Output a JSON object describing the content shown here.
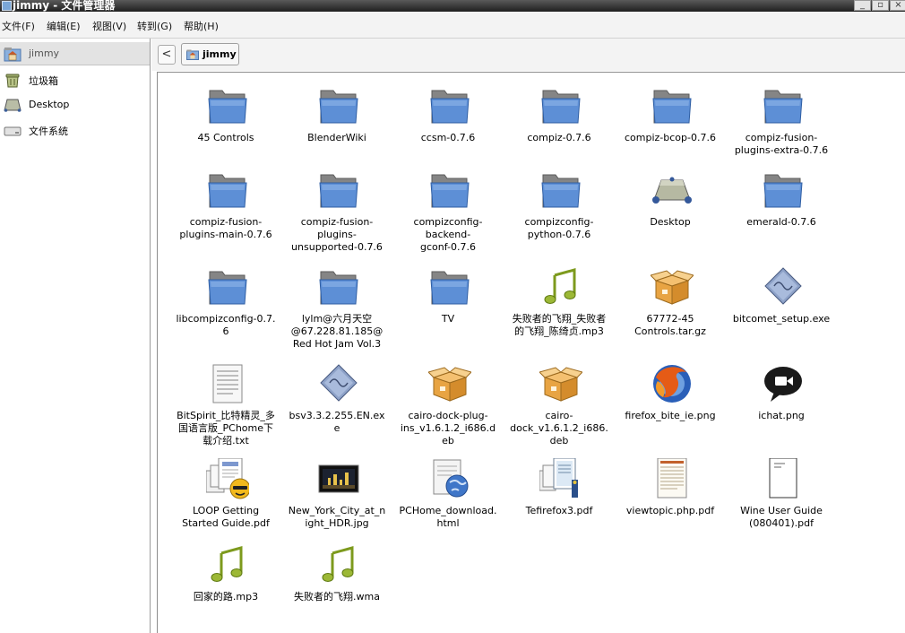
{
  "window": {
    "title": "jimmy - 文件管理器"
  },
  "menu": [
    "文件(F)",
    "编辑(E)",
    "视图(V)",
    "转到(G)",
    "帮助(H)"
  ],
  "sidebar": {
    "items": [
      {
        "label": "jimmy",
        "icon": "home-folder-icon",
        "selected": true
      },
      {
        "label": "垃圾箱",
        "icon": "trash-icon"
      },
      {
        "label": "Desktop",
        "icon": "desktop-icon"
      },
      {
        "label": "文件系统",
        "icon": "harddisk-icon"
      }
    ]
  },
  "pathbar": {
    "back_label": "<",
    "crumb": "jimmy",
    "crumb_icon": "home-folder-icon"
  },
  "files": [
    {
      "label": "45 Controls",
      "icon": "folder"
    },
    {
      "label": "BlenderWiki",
      "icon": "folder"
    },
    {
      "label": "ccsm-0.7.6",
      "icon": "folder"
    },
    {
      "label": "compiz-0.7.6",
      "icon": "folder"
    },
    {
      "label": "compiz-bcop-0.7.6",
      "icon": "folder"
    },
    {
      "label": "compiz-fusion-\nplugins-extra-0.7.6",
      "icon": "folder"
    },
    {
      "label": "compiz-fusion-\nplugins-main-0.7.6",
      "icon": "folder"
    },
    {
      "label": "compiz-fusion-\nplugins-\nunsupported-0.7.6",
      "icon": "folder"
    },
    {
      "label": "compizconfig-\nbackend-\ngconf-0.7.6",
      "icon": "folder"
    },
    {
      "label": "compizconfig-\npython-0.7.6",
      "icon": "folder"
    },
    {
      "label": "Desktop",
      "icon": "desktop"
    },
    {
      "label": "emerald-0.7.6",
      "icon": "folder"
    },
    {
      "label": "libcompizconfig-0.7.\n6",
      "icon": "folder"
    },
    {
      "label": "lylm@六月天空\n@67.228.81.185@\nRed Hot Jam Vol.3",
      "icon": "folder"
    },
    {
      "label": "TV",
      "icon": "folder"
    },
    {
      "label": "失败者的飞翔_失败者\n的飞翔_陈绮贞.mp3",
      "icon": "music"
    },
    {
      "label": "67772-45\nControls.tar.gz",
      "icon": "package"
    },
    {
      "label": "bitcomet_setup.exe",
      "icon": "executable"
    },
    {
      "label": "BitSpirit_比特精灵_多\n国语言版_PChome下\n载介绍.txt",
      "icon": "text"
    },
    {
      "label": "bsv3.3.2.255.EN.ex\ne",
      "icon": "executable"
    },
    {
      "label": "cairo-dock-plug-\nins_v1.6.1.2_i686.d\neb",
      "icon": "package"
    },
    {
      "label": "cairo-\ndock_v1.6.1.2_i686.\ndeb",
      "icon": "package"
    },
    {
      "label": "firefox_bite_ie.png",
      "icon": "firefox-image"
    },
    {
      "label": "ichat.png",
      "icon": "ichat-image"
    },
    {
      "label": "LOOP Getting\nStarted Guide.pdf",
      "icon": "pdf-loop"
    },
    {
      "label": "New_York_City_at_n\night_HDR.jpg",
      "icon": "photo"
    },
    {
      "label": "PCHome_download.\nhtml",
      "icon": "html"
    },
    {
      "label": "Tefirefox3.pdf",
      "icon": "pdf-tefirefox"
    },
    {
      "label": "viewtopic.php.pdf",
      "icon": "pdf-page"
    },
    {
      "label": "Wine User Guide\n(080401).pdf",
      "icon": "pdf-blank"
    },
    {
      "label": "回家的路.mp3",
      "icon": "music"
    },
    {
      "label": "失败者的飞翔.wma",
      "icon": "music"
    }
  ],
  "colors": {
    "folder_blue": "#5d8fd6",
    "music_green": "#8aa526",
    "package_tan": "#e8a443",
    "menubar": "#f3f3f3"
  }
}
